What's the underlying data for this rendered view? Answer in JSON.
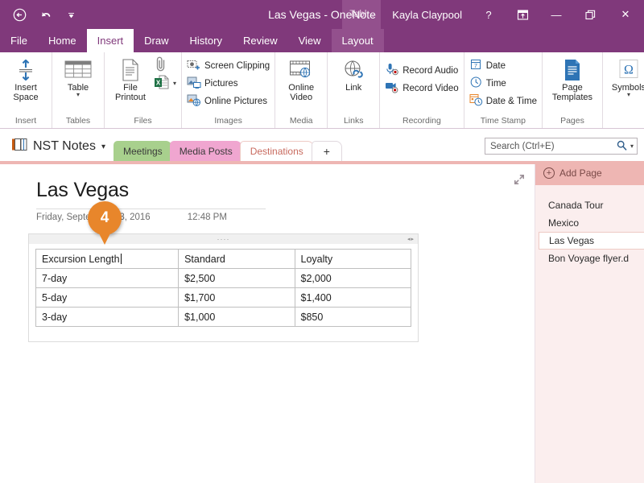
{
  "titlebar": {
    "back_icon": "back-arrow-icon",
    "undo_icon": "undo-icon",
    "customize_icon": "quick-access-dropdown-icon",
    "title": "Las Vegas - OneNote",
    "contextual_tab": "Tabl...",
    "user": "Kayla Claypool",
    "help": "?",
    "ribbon_display": "ribbon-display-options-icon",
    "minimize": "—",
    "restore": "restore-icon",
    "close": "✕",
    "accent": "#80397b"
  },
  "ribbon_tabs": [
    {
      "label": "File",
      "active": false,
      "ctx": false
    },
    {
      "label": "Home",
      "active": false,
      "ctx": false
    },
    {
      "label": "Insert",
      "active": true,
      "ctx": false
    },
    {
      "label": "Draw",
      "active": false,
      "ctx": false
    },
    {
      "label": "History",
      "active": false,
      "ctx": false
    },
    {
      "label": "Review",
      "active": false,
      "ctx": false
    },
    {
      "label": "View",
      "active": false,
      "ctx": false
    },
    {
      "label": "Layout",
      "active": false,
      "ctx": true
    }
  ],
  "ribbon_groups": [
    {
      "name": "Insert",
      "label": "Insert",
      "buttons": [
        {
          "label": "Insert Space",
          "icon": "insert-space-icon"
        }
      ]
    },
    {
      "name": "Tables",
      "label": "Tables",
      "buttons": [
        {
          "label": "Table",
          "icon": "table-icon",
          "caret": true
        }
      ]
    },
    {
      "name": "Files",
      "label": "Files",
      "buttons": [
        {
          "label": "File Printout",
          "icon": "file-printout-icon"
        },
        {
          "label": "",
          "icon": "attach-file-icon"
        },
        {
          "label": "",
          "icon": "spreadsheet-icon",
          "caret": true
        }
      ]
    },
    {
      "name": "Images",
      "label": "Images",
      "buttons": [
        {
          "label": "Screen Clipping",
          "icon": "screen-clipping-icon"
        },
        {
          "label": "Pictures",
          "icon": "pictures-icon"
        },
        {
          "label": "Online Pictures",
          "icon": "online-pictures-icon"
        }
      ]
    },
    {
      "name": "Media",
      "label": "Media",
      "buttons": [
        {
          "label": "Online Video",
          "icon": "online-video-icon"
        }
      ]
    },
    {
      "name": "Links",
      "label": "Links",
      "buttons": [
        {
          "label": "Link",
          "icon": "link-icon"
        }
      ]
    },
    {
      "name": "Recording",
      "label": "Recording",
      "buttons": [
        {
          "label": "Record Audio",
          "icon": "record-audio-icon"
        },
        {
          "label": "Record Video",
          "icon": "record-video-icon"
        }
      ]
    },
    {
      "name": "Time Stamp",
      "label": "Time Stamp",
      "buttons": [
        {
          "label": "Date",
          "icon": "date-icon"
        },
        {
          "label": "Time",
          "icon": "time-icon"
        },
        {
          "label": "Date & Time",
          "icon": "date-time-icon"
        }
      ]
    },
    {
      "name": "Pages",
      "label": "Pages",
      "buttons": [
        {
          "label": "Page Templates",
          "icon": "page-templates-icon",
          "caret": true
        }
      ]
    },
    {
      "name": "Symbols",
      "label": "",
      "buttons": [
        {
          "label": "Symbols",
          "icon": "omega-symbol-icon",
          "caret": true
        }
      ]
    }
  ],
  "ribbon_collapse_icon": "collapse-ribbon-chevron-icon",
  "notebook": {
    "icon": "notebook-icon",
    "name": "NST Notes",
    "caret": "▾"
  },
  "sections": [
    {
      "label": "Meetings",
      "color": "#a8d08d",
      "style": "green",
      "active": false
    },
    {
      "label": "Media Posts",
      "color": "#f0a6d0",
      "style": "pink",
      "active": false
    },
    {
      "label": "Destinations",
      "color": "#ffffff",
      "style": "active",
      "active": true
    },
    {
      "label": "+",
      "color": "#ffffff",
      "style": "plus",
      "active": false
    }
  ],
  "search": {
    "placeholder": "Search (Ctrl+E)",
    "icon": "search-icon",
    "caret": "▾"
  },
  "page": {
    "title": "Las Vegas",
    "date": "Friday, September 23, 2016",
    "time": "12:48 PM",
    "expand_icon": "expand-page-icon"
  },
  "table": {
    "handle_dots": "····",
    "handle_arrows": "◂▸",
    "rows": [
      [
        "Excursion Length",
        "Standard",
        "Loyalty"
      ],
      [
        "7-day",
        "$2,500",
        "$2,000"
      ],
      [
        "5-day",
        "$1,700",
        "$1,400"
      ],
      [
        "3-day",
        "$1,000",
        "$850"
      ]
    ]
  },
  "callout": {
    "number": "4",
    "color": "#e8862b"
  },
  "page_pane": {
    "add_page_label": "Add Page",
    "add_page_icon": "add-page-icon",
    "header_color": "#eeb6b3",
    "pages": [
      {
        "label": "Canada Tour",
        "active": false
      },
      {
        "label": "Mexico",
        "active": false
      },
      {
        "label": "Las Vegas",
        "active": true
      },
      {
        "label": "Bon Voyage flyer.d",
        "active": false
      }
    ]
  }
}
